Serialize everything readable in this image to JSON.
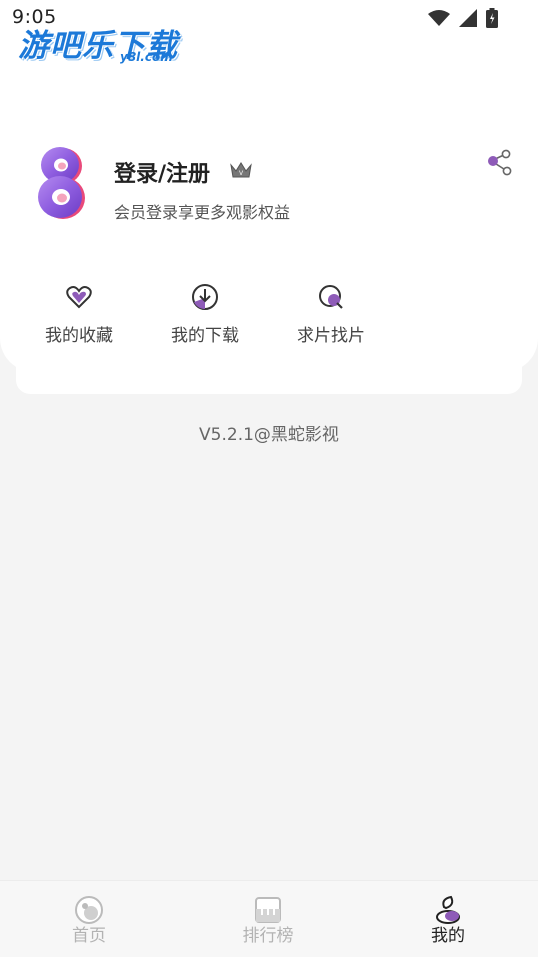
{
  "status_bar": {
    "time": "9:05",
    "icons": [
      "wifi-icon",
      "signal-icon",
      "battery-icon"
    ]
  },
  "watermark": {
    "text": "游吧乐下载",
    "sub": "y8l.com"
  },
  "profile": {
    "avatar_icon": "app-logo-8-icon",
    "login_label": "登录/注册",
    "vip_icon": "crown-icon",
    "subtitle": "会员登录享更多观影权益",
    "share_icon": "share-icon"
  },
  "quick_actions": [
    {
      "label": "我的收藏",
      "icon": "heart-icon"
    },
    {
      "label": "我的下载",
      "icon": "download-icon"
    },
    {
      "label": "求片找片",
      "icon": "search-icon"
    }
  ],
  "version_text": "V5.2.1@黑蛇影视",
  "bottom_nav": [
    {
      "label": "首页",
      "icon": "home-icon",
      "active": false
    },
    {
      "label": "排行榜",
      "icon": "ranking-icon",
      "active": false
    },
    {
      "label": "我的",
      "icon": "profile-icon",
      "active": true
    }
  ],
  "colors": {
    "accent": "#8e5bb8",
    "background": "#f4f4f4",
    "card": "#ffffff",
    "watermark": "#1c79d8"
  }
}
